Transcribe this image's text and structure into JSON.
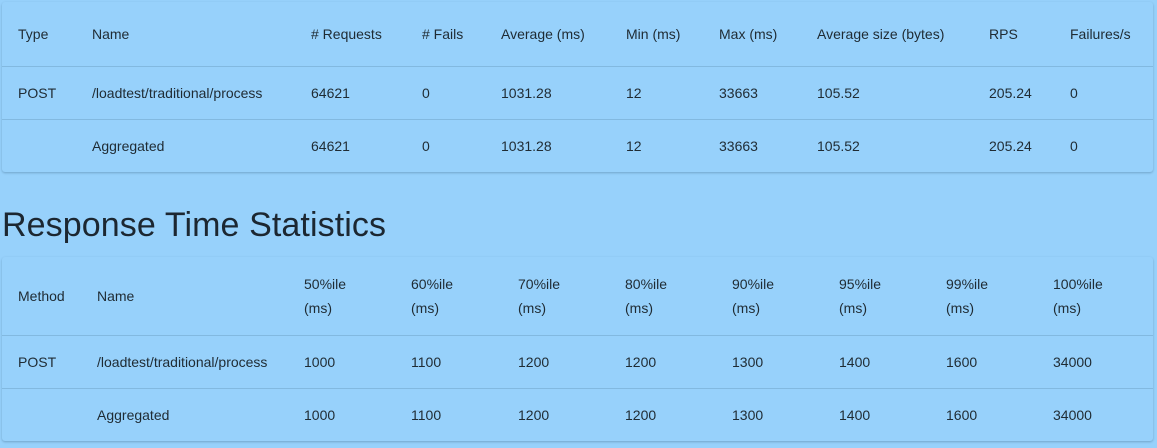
{
  "request_stats": {
    "headers": [
      "Type",
      "Name",
      "# Requests",
      "# Fails",
      "Average (ms)",
      "Min (ms)",
      "Max (ms)",
      "Average size (bytes)",
      "RPS",
      "Failures/s"
    ],
    "rows": [
      [
        "POST",
        "/loadtest/traditional/process",
        "64621",
        "0",
        "1031.28",
        "12",
        "33663",
        "105.52",
        "205.24",
        "0"
      ],
      [
        "",
        "Aggregated",
        "64621",
        "0",
        "1031.28",
        "12",
        "33663",
        "105.52",
        "205.24",
        "0"
      ]
    ]
  },
  "response_time": {
    "title": "Response Time Statistics",
    "headers": [
      "Method",
      "Name",
      "50%ile",
      "60%ile",
      "70%ile",
      "80%ile",
      "90%ile",
      "95%ile",
      "99%ile",
      "100%ile"
    ],
    "header_units": [
      "",
      "",
      "(ms)",
      "(ms)",
      "(ms)",
      "(ms)",
      "(ms)",
      "(ms)",
      "(ms)",
      "(ms)"
    ],
    "rows": [
      [
        "POST",
        "/loadtest/traditional/process",
        "1000",
        "1100",
        "1200",
        "1200",
        "1300",
        "1400",
        "1600",
        "34000"
      ],
      [
        "",
        "Aggregated",
        "1000",
        "1100",
        "1200",
        "1200",
        "1300",
        "1400",
        "1600",
        "34000"
      ]
    ]
  }
}
